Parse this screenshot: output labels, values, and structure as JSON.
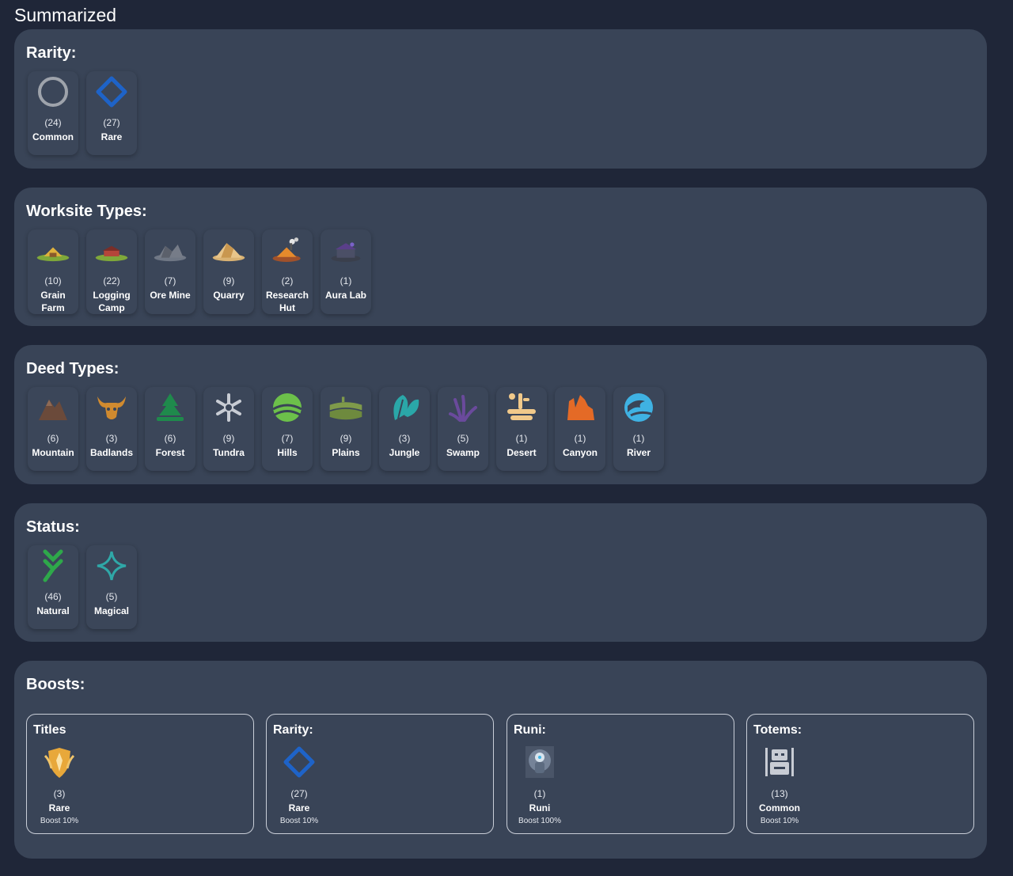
{
  "page_title": "Summarized",
  "rarity": {
    "title": "Rarity:",
    "items": [
      {
        "count": "(24)",
        "label": "Common",
        "icon": "common-circle-icon"
      },
      {
        "count": "(27)",
        "label": "Rare",
        "icon": "rare-diamond-icon"
      }
    ]
  },
  "worksite": {
    "title": "Worksite Types:",
    "items": [
      {
        "count": "(10)",
        "label": "Grain Farm",
        "icon": "grain-farm-icon"
      },
      {
        "count": "(22)",
        "label": "Logging Camp",
        "icon": "logging-camp-icon"
      },
      {
        "count": "(7)",
        "label": "Ore Mine",
        "icon": "ore-mine-icon"
      },
      {
        "count": "(9)",
        "label": "Quarry",
        "icon": "quarry-icon"
      },
      {
        "count": "(2)",
        "label": "Research Hut",
        "icon": "research-hut-icon"
      },
      {
        "count": "(1)",
        "label": "Aura Lab",
        "icon": "aura-lab-icon"
      }
    ]
  },
  "deed": {
    "title": "Deed Types:",
    "items": [
      {
        "count": "(6)",
        "label": "Mountain",
        "icon": "mountain-icon"
      },
      {
        "count": "(3)",
        "label": "Badlands",
        "icon": "badlands-skull-icon"
      },
      {
        "count": "(6)",
        "label": "Forest",
        "icon": "forest-tree-icon"
      },
      {
        "count": "(9)",
        "label": "Tundra",
        "icon": "snowflake-icon"
      },
      {
        "count": "(7)",
        "label": "Hills",
        "icon": "hills-icon"
      },
      {
        "count": "(9)",
        "label": "Plains",
        "icon": "plains-icon"
      },
      {
        "count": "(3)",
        "label": "Jungle",
        "icon": "jungle-leaf-icon"
      },
      {
        "count": "(5)",
        "label": "Swamp",
        "icon": "swamp-reeds-icon"
      },
      {
        "count": "(1)",
        "label": "Desert",
        "icon": "desert-cactus-icon"
      },
      {
        "count": "(1)",
        "label": "Canyon",
        "icon": "canyon-icon"
      },
      {
        "count": "(1)",
        "label": "River",
        "icon": "river-wave-icon"
      }
    ]
  },
  "status": {
    "title": "Status:",
    "items": [
      {
        "count": "(46)",
        "label": "Natural",
        "icon": "natural-icon"
      },
      {
        "count": "(5)",
        "label": "Magical",
        "icon": "magical-sparkle-icon"
      }
    ]
  },
  "boosts": {
    "title": "Boosts:",
    "boxes": [
      {
        "title": "Titles",
        "count": "(3)",
        "label": "Rare",
        "boost": "Boost 10%",
        "icon": "title-emblem-icon"
      },
      {
        "title": "Rarity:",
        "count": "(27)",
        "label": "Rare",
        "boost": "Boost 10%",
        "icon": "rare-diamond-icon"
      },
      {
        "title": "Runi:",
        "count": "(1)",
        "label": "Runi",
        "boost": "Boost 100%",
        "icon": "runi-icon"
      },
      {
        "title": "Totems:",
        "count": "(13)",
        "label": "Common",
        "boost": "Boost 10%",
        "icon": "totem-icon"
      }
    ]
  },
  "colors": {
    "background": "#1f2638",
    "panel": "#394457",
    "rare_blue": "#1e63c8",
    "common_gray": "#9ea3ab"
  }
}
